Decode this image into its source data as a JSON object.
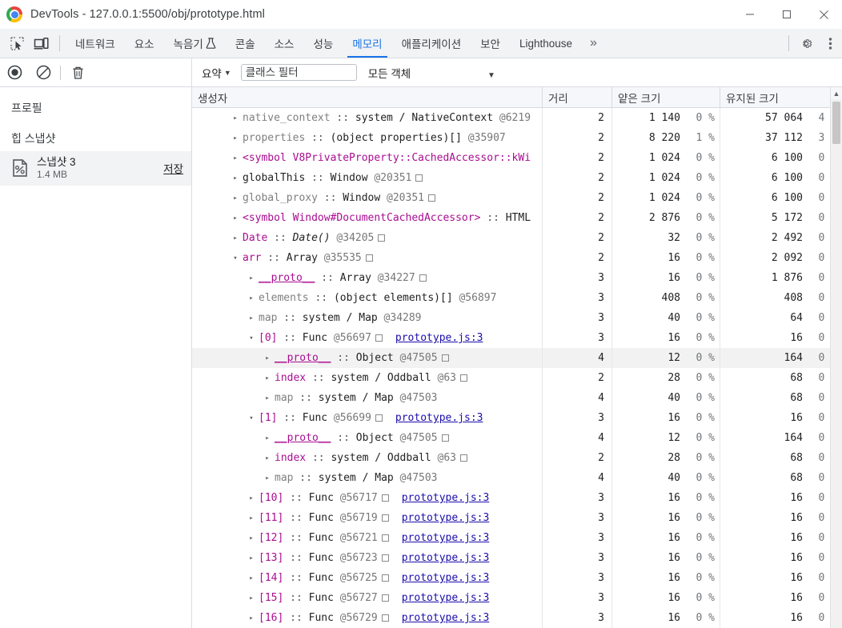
{
  "window": {
    "title": "DevTools - 127.0.0.1:5500/obj/prototype.html",
    "controls": {
      "minimize": "minimize-icon",
      "maximize": "maximize-icon",
      "close": "close-icon"
    }
  },
  "tabbar": {
    "inspect_icon": "inspect-element-icon",
    "device_icon": "device-toolbar-icon",
    "tabs": [
      {
        "label": "네트워크",
        "active": false
      },
      {
        "label": "요소",
        "active": false
      },
      {
        "label": "녹음기",
        "active": false,
        "flask": true
      },
      {
        "label": "콘솔",
        "active": false
      },
      {
        "label": "소스",
        "active": false
      },
      {
        "label": "성능",
        "active": false
      },
      {
        "label": "메모리",
        "active": true
      },
      {
        "label": "애플리케이션",
        "active": false
      },
      {
        "label": "보안",
        "active": false
      },
      {
        "label": "Lighthouse",
        "active": false
      }
    ],
    "more_label": "»",
    "settings_icon": "gear-icon",
    "menu_icon": "more-vertical-icon"
  },
  "toolbar": {
    "record_icon": "record-icon",
    "clear_icon": "stop-clear-icon",
    "delete_icon": "trash-icon",
    "summary_label": "요약",
    "summary_caret": "▼",
    "filter_placeholder": "클래스 필터",
    "filter_value": "",
    "objects_label": "모든 객체",
    "objects_caret": "▼"
  },
  "sidebar": {
    "profiles_heading": "프로필",
    "heap_heading": "힙 스냅샷",
    "snapshot": {
      "icon": "snapshot-document-icon",
      "name": "스냅샷 3",
      "size": "1.4 MB",
      "save_label": "저장"
    }
  },
  "grid": {
    "columns": [
      {
        "key": "constructor",
        "label": "생성자"
      },
      {
        "key": "distance",
        "label": "거리"
      },
      {
        "key": "shallow",
        "label": "얕은 크기"
      },
      {
        "key": "retained",
        "label": "유지된 크기",
        "sorted": true,
        "sort_arrow": "▼"
      }
    ],
    "rows": [
      {
        "indent": 1,
        "tri": "▸",
        "name": "native_context",
        "name_color": "gray",
        "sep": " :: ",
        "cls": "system / NativeContext",
        "at": "@6219",
        "box": false,
        "truncated": true,
        "src": "",
        "distance": "2",
        "shallow": "1 140",
        "shallow_pct": "0 %",
        "retained": "57 064",
        "retained_pct": "4 %",
        "selected": false
      },
      {
        "indent": 1,
        "tri": "▸",
        "name": "properties",
        "name_color": "gray",
        "sep": " :: ",
        "cls": "(object properties)[]",
        "at": "@35907",
        "box": false,
        "src": "",
        "distance": "2",
        "shallow": "8 220",
        "shallow_pct": "1 %",
        "retained": "37 112",
        "retained_pct": "3 %",
        "selected": false
      },
      {
        "indent": 1,
        "tri": "▸",
        "name": "<symbol V8PrivateProperty::CachedAccessor::kWi",
        "name_color": "purple",
        "sep": "",
        "cls": "",
        "at": "",
        "box": false,
        "truncated": true,
        "src": "",
        "distance": "2",
        "shallow": "1 024",
        "shallow_pct": "0 %",
        "retained": "6 100",
        "retained_pct": "0 %",
        "selected": false
      },
      {
        "indent": 1,
        "tri": "▸",
        "name": "globalThis",
        "name_color": "black",
        "sep": " :: ",
        "cls": "Window",
        "at": "@20351",
        "box": true,
        "src": "",
        "distance": "2",
        "shallow": "1 024",
        "shallow_pct": "0 %",
        "retained": "6 100",
        "retained_pct": "0 %",
        "selected": false
      },
      {
        "indent": 1,
        "tri": "▸",
        "name": "global_proxy",
        "name_color": "gray",
        "sep": " :: ",
        "cls": "Window",
        "at": "@20351",
        "box": true,
        "src": "",
        "distance": "2",
        "shallow": "1 024",
        "shallow_pct": "0 %",
        "retained": "6 100",
        "retained_pct": "0 %",
        "selected": false
      },
      {
        "indent": 1,
        "tri": "▸",
        "name": "<symbol Window#DocumentCachedAccessor>",
        "name_color": "purple",
        "sep": " :: ",
        "cls": "HTML",
        "at": "",
        "box": false,
        "truncated": true,
        "src": "",
        "distance": "2",
        "shallow": "2 876",
        "shallow_pct": "0 %",
        "retained": "5 172",
        "retained_pct": "0 %",
        "selected": false
      },
      {
        "indent": 1,
        "tri": "▸",
        "name": "Date",
        "name_color": "purple",
        "sep": " :: ",
        "cls": "Date()",
        "cls_italic": true,
        "at": "@34205",
        "box": true,
        "src": "",
        "distance": "2",
        "shallow": "32",
        "shallow_pct": "0 %",
        "retained": "2 492",
        "retained_pct": "0 %",
        "selected": false
      },
      {
        "indent": 1,
        "tri": "▾",
        "name": "arr",
        "name_color": "purple",
        "sep": " :: ",
        "cls": "Array",
        "at": "@35535",
        "box": true,
        "src": "",
        "distance": "2",
        "shallow": "16",
        "shallow_pct": "0 %",
        "retained": "2 092",
        "retained_pct": "0 %",
        "selected": false
      },
      {
        "indent": 2,
        "tri": "▸",
        "name": "__proto__",
        "name_color": "purple",
        "underline": true,
        "sep": " :: ",
        "cls": "Array",
        "at": "@34227",
        "box": true,
        "src": "",
        "distance": "3",
        "shallow": "16",
        "shallow_pct": "0 %",
        "retained": "1 876",
        "retained_pct": "0 %",
        "selected": false
      },
      {
        "indent": 2,
        "tri": "▸",
        "name": "elements",
        "name_color": "gray",
        "sep": " :: ",
        "cls": "(object elements)[]",
        "at": "@56897",
        "box": false,
        "src": "",
        "distance": "3",
        "shallow": "408",
        "shallow_pct": "0 %",
        "retained": "408",
        "retained_pct": "0 %",
        "selected": false
      },
      {
        "indent": 2,
        "tri": "▸",
        "name": "map",
        "name_color": "gray",
        "sep": " :: ",
        "cls": "system / Map",
        "at": "@34289",
        "box": false,
        "src": "",
        "distance": "3",
        "shallow": "40",
        "shallow_pct": "0 %",
        "retained": "64",
        "retained_pct": "0 %",
        "selected": false
      },
      {
        "indent": 2,
        "tri": "▾",
        "name": "[0]",
        "name_color": "purple",
        "sep": " :: ",
        "cls": "Func",
        "at": "@56697",
        "box": true,
        "src": "prototype.js:3",
        "distance": "3",
        "shallow": "16",
        "shallow_pct": "0 %",
        "retained": "16",
        "retained_pct": "0 %",
        "selected": false
      },
      {
        "indent": 3,
        "tri": "▸",
        "name": "__proto__",
        "name_color": "purple",
        "underline": true,
        "sep": " :: ",
        "cls": "Object",
        "at": "@47505",
        "box": true,
        "src": "",
        "distance": "4",
        "shallow": "12",
        "shallow_pct": "0 %",
        "retained": "164",
        "retained_pct": "0 %",
        "selected": true
      },
      {
        "indent": 3,
        "tri": "▸",
        "name": "index",
        "name_color": "purple",
        "sep": " :: ",
        "cls": "system / Oddball",
        "at": "@63",
        "box": true,
        "src": "",
        "distance": "2",
        "shallow": "28",
        "shallow_pct": "0 %",
        "retained": "68",
        "retained_pct": "0 %",
        "selected": false
      },
      {
        "indent": 3,
        "tri": "▸",
        "name": "map",
        "name_color": "gray",
        "sep": " :: ",
        "cls": "system / Map",
        "at": "@47503",
        "box": false,
        "src": "",
        "distance": "4",
        "shallow": "40",
        "shallow_pct": "0 %",
        "retained": "68",
        "retained_pct": "0 %",
        "selected": false
      },
      {
        "indent": 2,
        "tri": "▾",
        "name": "[1]",
        "name_color": "purple",
        "sep": " :: ",
        "cls": "Func",
        "at": "@56699",
        "box": true,
        "src": "prototype.js:3",
        "distance": "3",
        "shallow": "16",
        "shallow_pct": "0 %",
        "retained": "16",
        "retained_pct": "0 %",
        "selected": false
      },
      {
        "indent": 3,
        "tri": "▸",
        "name": "__proto__",
        "name_color": "purple",
        "underline": true,
        "sep": " :: ",
        "cls": "Object",
        "at": "@47505",
        "box": true,
        "src": "",
        "distance": "4",
        "shallow": "12",
        "shallow_pct": "0 %",
        "retained": "164",
        "retained_pct": "0 %",
        "selected": false
      },
      {
        "indent": 3,
        "tri": "▸",
        "name": "index",
        "name_color": "purple",
        "sep": " :: ",
        "cls": "system / Oddball",
        "at": "@63",
        "box": true,
        "src": "",
        "distance": "2",
        "shallow": "28",
        "shallow_pct": "0 %",
        "retained": "68",
        "retained_pct": "0 %",
        "selected": false
      },
      {
        "indent": 3,
        "tri": "▸",
        "name": "map",
        "name_color": "gray",
        "sep": " :: ",
        "cls": "system / Map",
        "at": "@47503",
        "box": false,
        "src": "",
        "distance": "4",
        "shallow": "40",
        "shallow_pct": "0 %",
        "retained": "68",
        "retained_pct": "0 %",
        "selected": false
      },
      {
        "indent": 2,
        "tri": "▸",
        "name": "[10]",
        "name_color": "purple",
        "sep": " :: ",
        "cls": "Func",
        "at": "@56717",
        "box": true,
        "src": "prototype.js:3",
        "distance": "3",
        "shallow": "16",
        "shallow_pct": "0 %",
        "retained": "16",
        "retained_pct": "0 %",
        "selected": false
      },
      {
        "indent": 2,
        "tri": "▸",
        "name": "[11]",
        "name_color": "purple",
        "sep": " :: ",
        "cls": "Func",
        "at": "@56719",
        "box": true,
        "src": "prototype.js:3",
        "distance": "3",
        "shallow": "16",
        "shallow_pct": "0 %",
        "retained": "16",
        "retained_pct": "0 %",
        "selected": false
      },
      {
        "indent": 2,
        "tri": "▸",
        "name": "[12]",
        "name_color": "purple",
        "sep": " :: ",
        "cls": "Func",
        "at": "@56721",
        "box": true,
        "src": "prototype.js:3",
        "distance": "3",
        "shallow": "16",
        "shallow_pct": "0 %",
        "retained": "16",
        "retained_pct": "0 %",
        "selected": false
      },
      {
        "indent": 2,
        "tri": "▸",
        "name": "[13]",
        "name_color": "purple",
        "sep": " :: ",
        "cls": "Func",
        "at": "@56723",
        "box": true,
        "src": "prototype.js:3",
        "distance": "3",
        "shallow": "16",
        "shallow_pct": "0 %",
        "retained": "16",
        "retained_pct": "0 %",
        "selected": false
      },
      {
        "indent": 2,
        "tri": "▸",
        "name": "[14]",
        "name_color": "purple",
        "sep": " :: ",
        "cls": "Func",
        "at": "@56725",
        "box": true,
        "src": "prototype.js:3",
        "distance": "3",
        "shallow": "16",
        "shallow_pct": "0 %",
        "retained": "16",
        "retained_pct": "0 %",
        "selected": false
      },
      {
        "indent": 2,
        "tri": "▸",
        "name": "[15]",
        "name_color": "purple",
        "sep": " :: ",
        "cls": "Func",
        "at": "@56727",
        "box": true,
        "src": "prototype.js:3",
        "distance": "3",
        "shallow": "16",
        "shallow_pct": "0 %",
        "retained": "16",
        "retained_pct": "0 %",
        "selected": false
      },
      {
        "indent": 2,
        "tri": "▸",
        "name": "[16]",
        "name_color": "purple",
        "sep": " :: ",
        "cls": "Func",
        "at": "@56729",
        "box": true,
        "src": "prototype.js:3",
        "distance": "3",
        "shallow": "16",
        "shallow_pct": "0 %",
        "retained": "16",
        "retained_pct": "0 %",
        "selected": false
      }
    ],
    "scroll_up_icon": "▲"
  },
  "colors": {
    "accent": "#1a73e8",
    "property_name": "#aa0d91",
    "link": "#1a0dab",
    "chrome_border": "#dadce0"
  }
}
